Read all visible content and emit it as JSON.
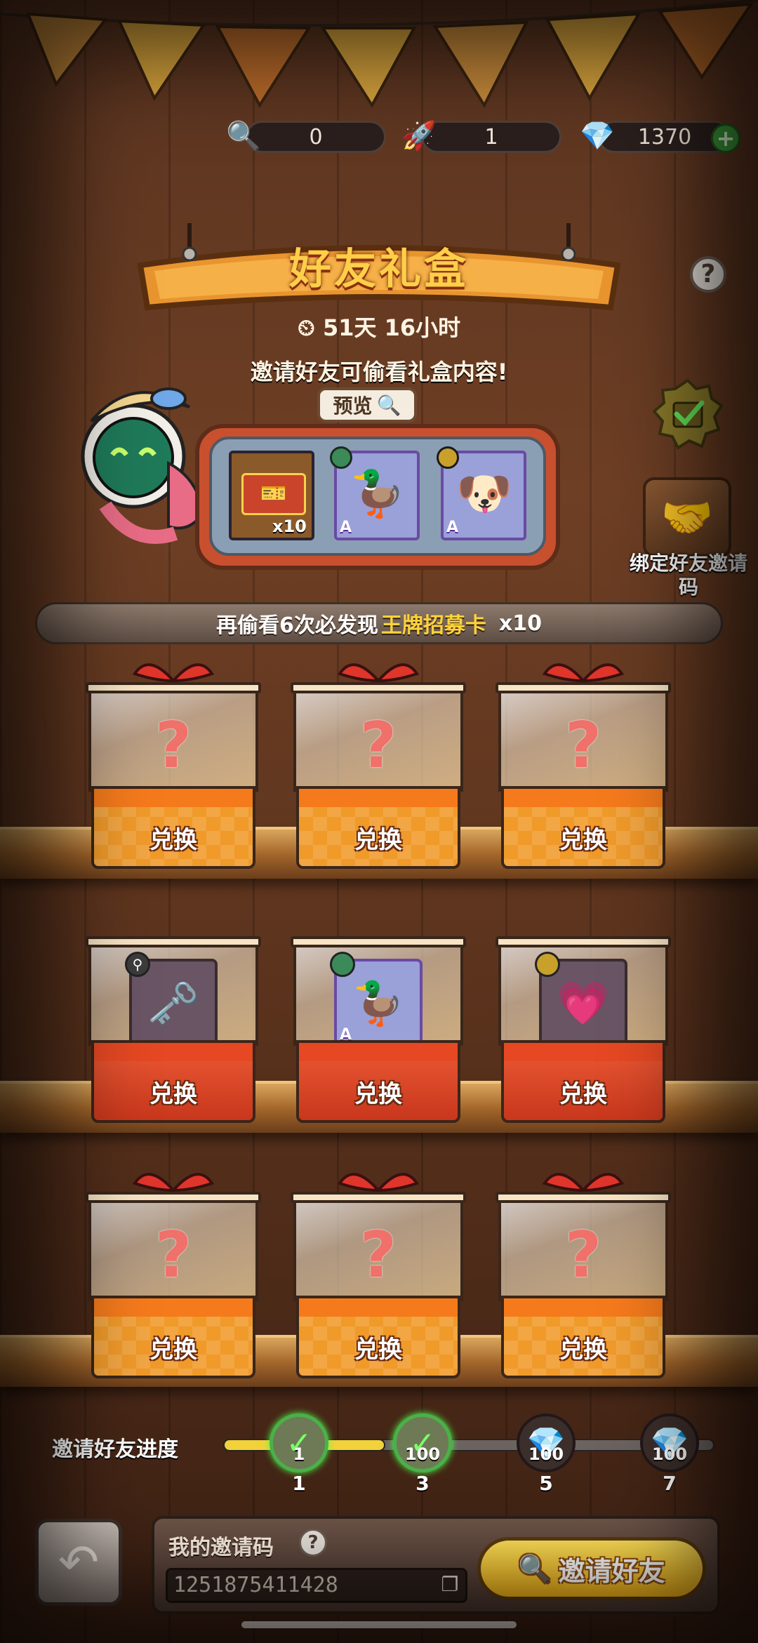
{
  "currency": {
    "magnifier": "0",
    "rocket": "1",
    "gems": "1370"
  },
  "header": {
    "title": "好友礼盒",
    "timer": "51天 16小时",
    "tip": "邀请好友可偷看礼盒内容!"
  },
  "preview": {
    "tab_label": "预览",
    "items": [
      {
        "name": "ticket",
        "count": "x10"
      },
      {
        "name": "duck-chef-card",
        "rank": "A"
      },
      {
        "name": "dog-pilot-card",
        "rank": "A"
      }
    ]
  },
  "side": {
    "bind_label": "绑定好友邀请码"
  },
  "banner": {
    "prefix": "再偷看6次必发现",
    "highlight": "王牌招募卡",
    "suffix": "x10"
  },
  "boxes": {
    "redeem_label": "兑换",
    "row1": [
      "?",
      "?",
      "?"
    ],
    "row2": [
      {
        "name": "key-item"
      },
      {
        "name": "duck-chef-card",
        "rank": "A"
      },
      {
        "name": "heart-wings-item"
      }
    ],
    "row3": [
      "?",
      "?",
      "?"
    ]
  },
  "progress": {
    "label": "邀请好友进度",
    "fill_fraction": 0.33,
    "nodes": [
      {
        "step": "1",
        "amount": "1",
        "done": true
      },
      {
        "step": "3",
        "amount": "100",
        "done": true
      },
      {
        "step": "5",
        "amount": "100",
        "done": false
      },
      {
        "step": "7",
        "amount": "100",
        "done": false
      }
    ]
  },
  "footer": {
    "code_title": "我的邀请码",
    "code_value": "1251875411428",
    "invite_label": "邀请好友"
  },
  "colors": {
    "accent_gold": "#ffcf4a",
    "button_yellow": "#f4b317",
    "progress_fill": "#f2d23a"
  }
}
